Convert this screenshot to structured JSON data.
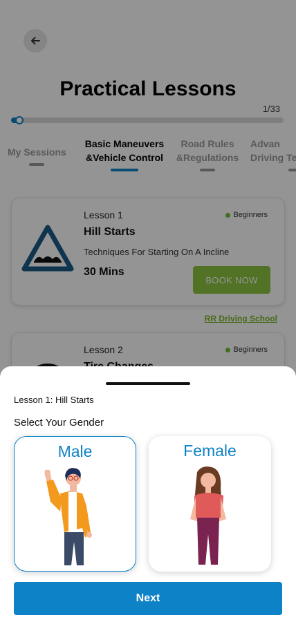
{
  "header": {
    "title": "Practical Lessons",
    "back_icon": "arrow-left-icon"
  },
  "progress": {
    "label": "1/33",
    "value": 1,
    "total": 33
  },
  "tabs": [
    {
      "label": "My Sessions",
      "active": false
    },
    {
      "label": "Basic Maneuvers\n&Vehicle Control",
      "active": true
    },
    {
      "label": "Road Rules\n&Regulations",
      "active": false
    },
    {
      "label": "Advan\nDriving Tec",
      "active": false
    }
  ],
  "lessons": [
    {
      "number": "Lesson 1",
      "title": "Hill Starts",
      "description": "Techniques For Starting On A Incline",
      "duration": "30 Mins",
      "badge": "Beginners",
      "button": "BOOK NOW",
      "icon": "road-hump-sign-icon"
    },
    {
      "number": "Lesson 2",
      "title": "Tire Changes",
      "badge": "Beginners",
      "icon": "tire-icon"
    }
  ],
  "school_link": "RR Driving School",
  "sheet": {
    "lesson": "Lesson 1: Hill Starts",
    "prompt": "Select Your Gender",
    "options": [
      {
        "label": "Male",
        "selected": true
      },
      {
        "label": "Female",
        "selected": false
      }
    ],
    "next_label": "Next"
  },
  "colors": {
    "primary": "#0e82c7",
    "book_button": "#8ec641",
    "school_link": "#7fb72c",
    "overlay": "rgba(0,0,0,0.42)"
  }
}
